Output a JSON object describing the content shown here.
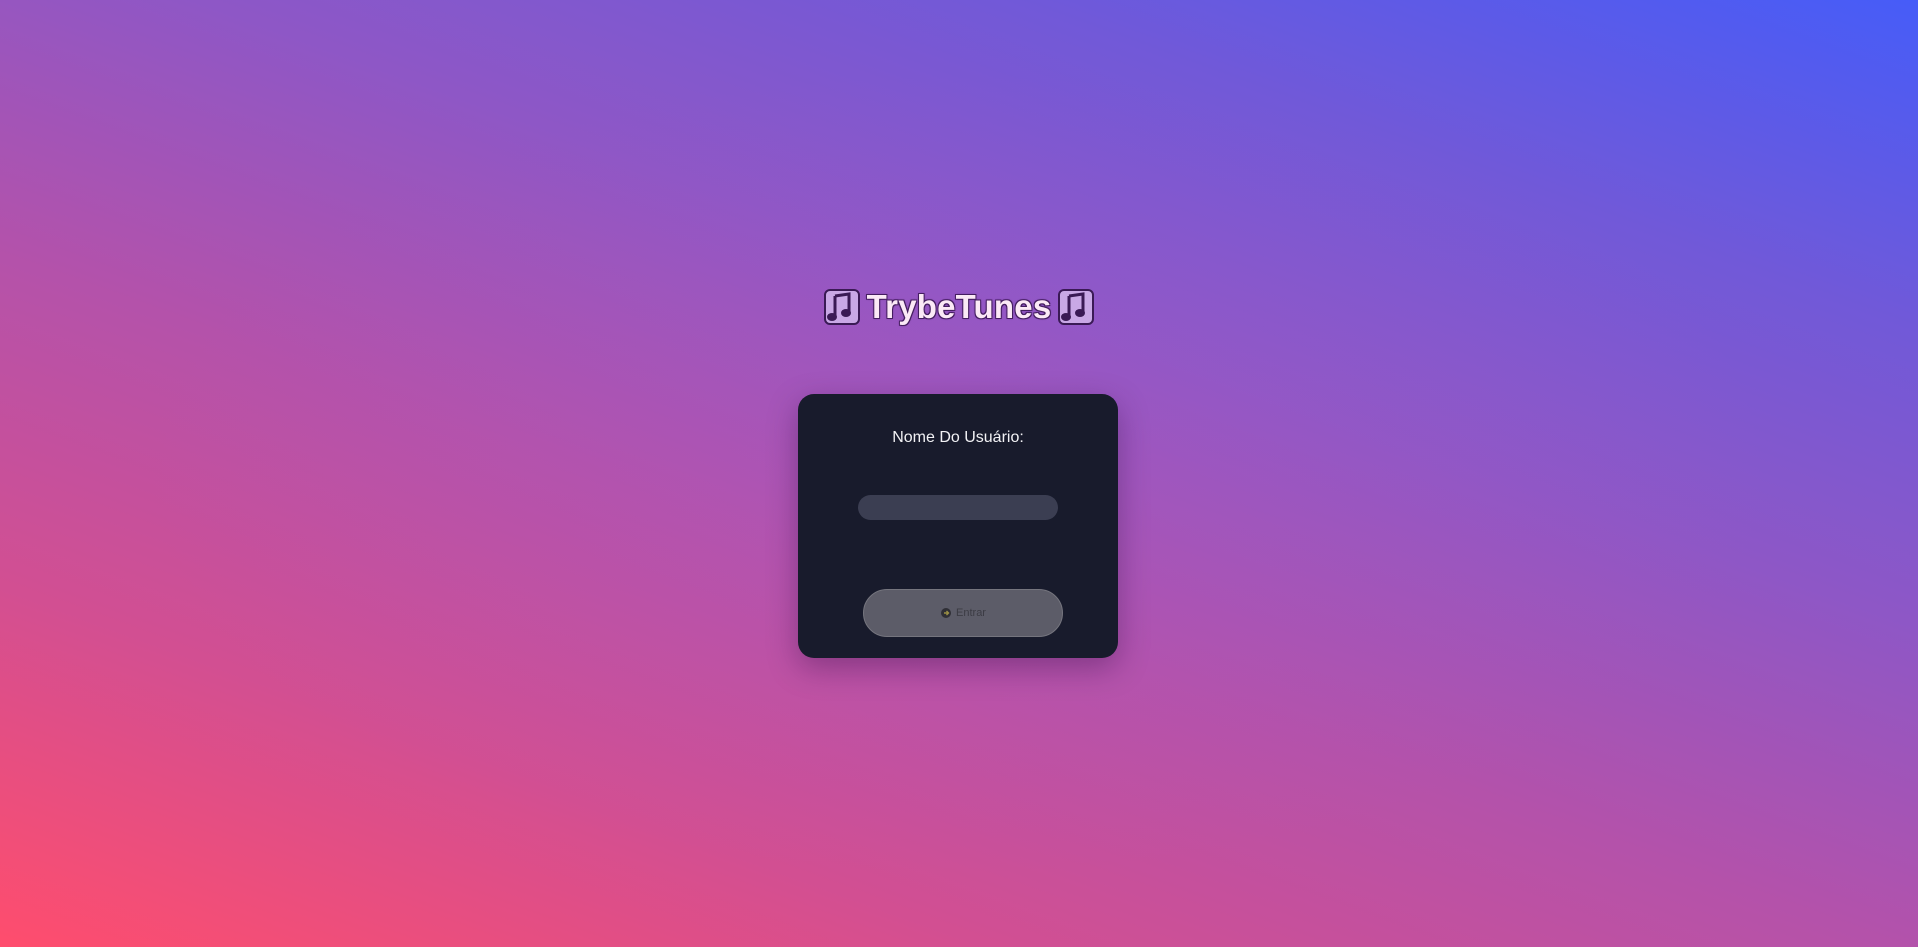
{
  "header": {
    "title": "TrybeTunes",
    "left_icon": "musical-notes-icon",
    "right_icon": "musical-notes-icon"
  },
  "login": {
    "label": "Nome Do Usuário:",
    "input_value": "",
    "input_placeholder": "",
    "button_label": "Entrar",
    "button_icon": "enter-icon",
    "button_state": "disabled"
  },
  "colors": {
    "gradient_bottom_left": "#ff4d6d",
    "gradient_top_right": "#465cf8",
    "card_background": "#181b2c",
    "input_background": "#3b3e52",
    "button_background": "#5c5c68",
    "title_text": "#fbe9f6"
  }
}
